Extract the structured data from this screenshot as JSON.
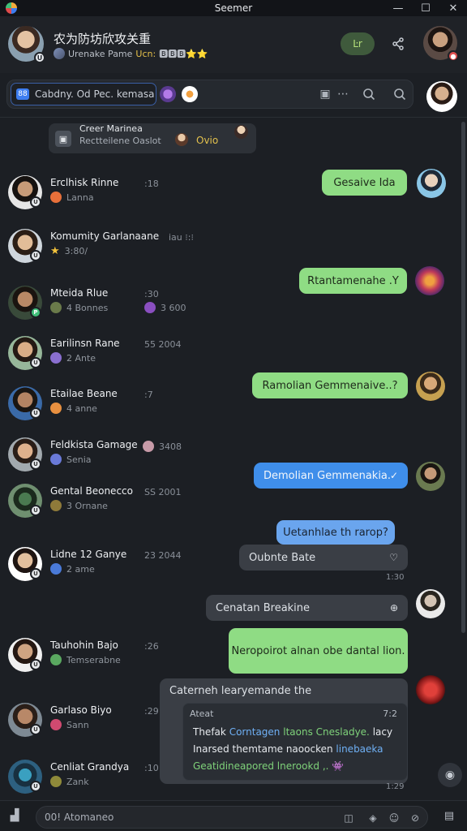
{
  "window": {
    "title": "Seemer",
    "controls": [
      "—",
      "☐",
      "✕"
    ]
  },
  "header": {
    "group_name": "农为防坊欣攻关重",
    "sub_text": "Urenake Pame",
    "sub_tag": "Ucn:",
    "sub_emojis": "🅱🅱🅱⭐⭐",
    "pill_label": "Ŀr",
    "share_icon": "share-icon"
  },
  "search": {
    "value": "Cabdny. Od Pec. kemasa"
  },
  "pinned": {
    "title": "Creer Marinea",
    "subtitle": "Rectteilene Oaslot",
    "quote": "Ovio"
  },
  "contacts": [
    {
      "name": "Erclhisk Rinne",
      "time": ":18",
      "sub": "Lanna",
      "extra": ""
    },
    {
      "name": "Komumity Garlanaane",
      "time": "iau ⁝:⁝",
      "sub": "3:80/",
      "extra": ""
    },
    {
      "name": "Mteida Rlue",
      "time": ":30",
      "sub": "4 Bonnes",
      "extra": "3 600"
    },
    {
      "name": "Earilinsn Rane",
      "time": "55   2004",
      "sub": "2 Ante",
      "extra": ""
    },
    {
      "name": "Etailae Beane",
      "time": ":7",
      "sub": "4 anne",
      "extra": ""
    },
    {
      "name": "Feldkista Gamage",
      "time": "3408",
      "sub": "Senia",
      "extra": ""
    },
    {
      "name": "Gental Beonecco",
      "time": "SS   2001",
      "sub": "3 Ornane",
      "extra": ""
    },
    {
      "name": "Lidne 12 Ganye",
      "time": "23   2044",
      "sub": "2 ame",
      "extra": ""
    },
    {
      "name": "Tauhohin Bajo",
      "time": ":26",
      "sub": "Temserabne",
      "extra": ""
    },
    {
      "name": "Garlaso Biyo",
      "time": ":29",
      "sub": "Sann",
      "extra": ""
    },
    {
      "name": "Cenliat Grandya",
      "time": ":10",
      "sub": "Zank",
      "extra": ""
    }
  ],
  "messages": [
    {
      "text": "Gesaive Ida",
      "style": "green"
    },
    {
      "text": "Rtantamenahe .Y",
      "style": "green"
    },
    {
      "text": "Ramolian Gemmenaive..?",
      "style": "green"
    },
    {
      "text": "Demolian Gemmenakia.",
      "style": "blue",
      "icon": "✓"
    },
    {
      "text": "Uetanhlae th rarop?",
      "style": "blue-light"
    },
    {
      "text": "Oubnte Bate",
      "style": "gray",
      "icon": "♡"
    },
    {
      "text": "Cenatan Breakine",
      "style": "gray",
      "icon": "⊕"
    },
    {
      "text": "Neropoirot alnan obe dantal lion.",
      "style": "green"
    },
    {
      "text": "Caterneh learyemande the",
      "style": "gray"
    }
  ],
  "timestamps": [
    "1:30",
    "1:29"
  ],
  "quote_card": {
    "head": "Ateat",
    "time": "7:2",
    "line1_a": "Thefak",
    "line1_b": "Corntagen",
    "line1_c": "ltaons Cnesladye.",
    "line1_d": "lacy",
    "line2_a": "Inarsed themtame naoocken",
    "line2_b": "linebaeka",
    "line3": "Geatidineapored lnerookd ,. 👾"
  },
  "composer": {
    "placeholder": "00! Atomaneo"
  },
  "colors": {
    "green_bubble": "#8fdc84",
    "blue_bubble": "#3f8eea",
    "background": "#1c1f24"
  }
}
